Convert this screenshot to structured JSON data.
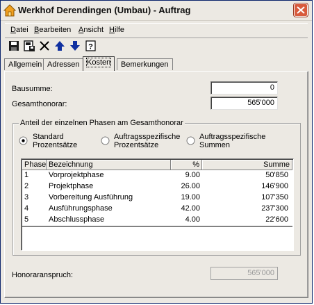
{
  "window": {
    "title": "Werkhof Derendingen (Umbau) - Auftrag"
  },
  "menu": [
    "Datei",
    "Bearbeiten",
    "Ansicht",
    "Hilfe"
  ],
  "menu_underline": [
    "D",
    "B",
    "A",
    "H"
  ],
  "toolbar": {
    "icons": [
      "save-icon",
      "save-close-icon",
      "delete-icon",
      "arrow-up-icon",
      "arrow-down-icon",
      "help-icon"
    ]
  },
  "tabs": [
    {
      "label": "Allgemein",
      "active": false
    },
    {
      "label": "Adressen",
      "active": false
    },
    {
      "label": "Kosten",
      "active": true
    },
    {
      "label": "Bemerkungen",
      "active": false
    }
  ],
  "fields": {
    "bausumme_label": "Bausumme:",
    "bausumme_value": "0",
    "gesamthonorar_label": "Gesamthonorar:",
    "gesamthonorar_value": "565'000",
    "honoraranspruch_label": "Honoraranspruch:",
    "honoraranspruch_value": "565'000"
  },
  "group": {
    "legend": "Anteil der einzelnen Phasen am Gesamthonorar",
    "radios": [
      {
        "line1": "Standard",
        "line2": "Prozentsätze",
        "checked": true
      },
      {
        "line1": "Auftragsspezifische",
        "line2": "Prozentsätze",
        "checked": false
      },
      {
        "line1": "Auftragsspezifische",
        "line2": "Summen",
        "checked": false
      }
    ]
  },
  "table": {
    "columns": [
      "Phase",
      "Bezeichnung",
      "%",
      "Summe"
    ],
    "rows": [
      [
        "1",
        "Vorprojektphase",
        "9.00",
        "50'850"
      ],
      [
        "2",
        "Projektphase",
        "26.00",
        "146'900"
      ],
      [
        "3",
        "Vorbereitung Ausführung",
        "19.00",
        "107'350"
      ],
      [
        "4",
        "Ausführungsphase",
        "42.00",
        "237'300"
      ],
      [
        "5",
        "Abschlussphase",
        "4.00",
        "22'600"
      ]
    ]
  }
}
